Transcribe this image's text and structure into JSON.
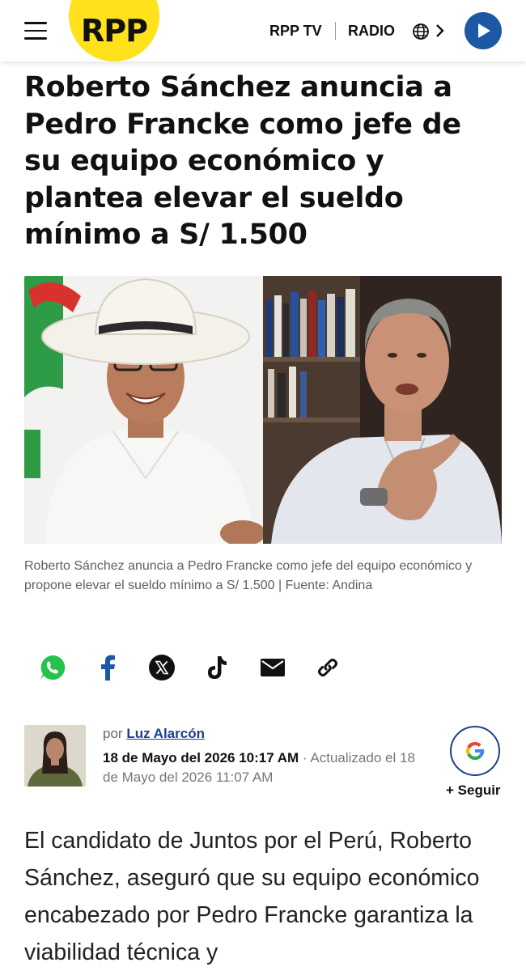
{
  "header": {
    "logo": "RPP",
    "nav_tv": "RPP TV",
    "nav_radio": "RADIO",
    "menu_icon": "hamburger-menu-icon",
    "globe_icon": "globe-icon",
    "play_icon": "play-icon",
    "brand_yellow": "#ffe11c",
    "brand_blue": "#1c58a6"
  },
  "article": {
    "title": "Roberto Sánchez anuncia a Pedro Francke como jefe de su equipo económico y plantea elevar el sueldo mínimo a S/ 1.500",
    "caption": "Roberto Sánchez anuncia a Pedro Francke como jefe del equipo económico y propone elevar el sueldo mínimo a S/ 1.500 | Fuente: Andina",
    "share_icons": [
      "whatsapp-icon",
      "facebook-icon",
      "x-icon",
      "tiktok-icon",
      "email-icon",
      "link-icon"
    ],
    "author": {
      "by": "por",
      "name": "Luz Alarcón",
      "published": "18 de Mayo del 2026 10:17 AM",
      "updated_prefix": "· Actualizado",
      "updated": "el 18 de Mayo del 2026 11:07 AM"
    },
    "follow_label": "+ Seguir",
    "body": "El candidato de Juntos por el Perú, Roberto Sánchez, aseguró que su equipo económico encabezado por Pedro Francke garantiza la viabilidad técnica y"
  }
}
